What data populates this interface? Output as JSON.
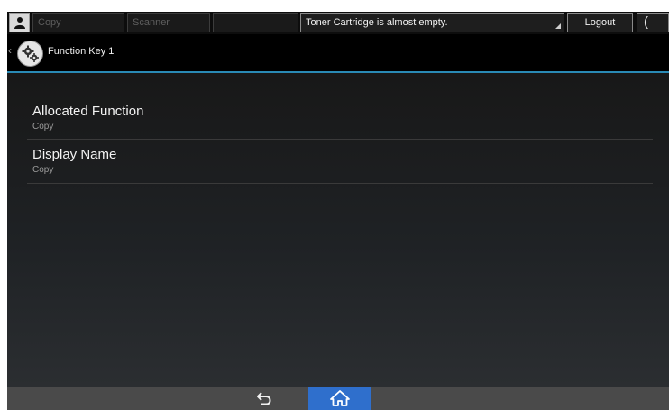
{
  "topbar": {
    "user_icon": "user-icon",
    "tabs": [
      {
        "label": "Copy"
      },
      {
        "label": "Scanner"
      },
      {
        "label": ""
      }
    ],
    "message": "Toner Cartridge is almost empty.",
    "logout_label": "Logout",
    "moon_icon": "moon-icon",
    "moon_glyph": "("
  },
  "titlebar": {
    "back_glyph": "‹",
    "icon": "gear-icon",
    "title": "Function Key 1"
  },
  "settings": [
    {
      "label": "Allocated Function",
      "value": "Copy"
    },
    {
      "label": "Display Name",
      "value": "Copy"
    }
  ],
  "bottombar": {
    "back_icon": "back-arrow-icon",
    "home_icon": "home-icon"
  },
  "colors": {
    "accent_line": "#2a8ab5",
    "home_button": "#2f6fcc"
  }
}
